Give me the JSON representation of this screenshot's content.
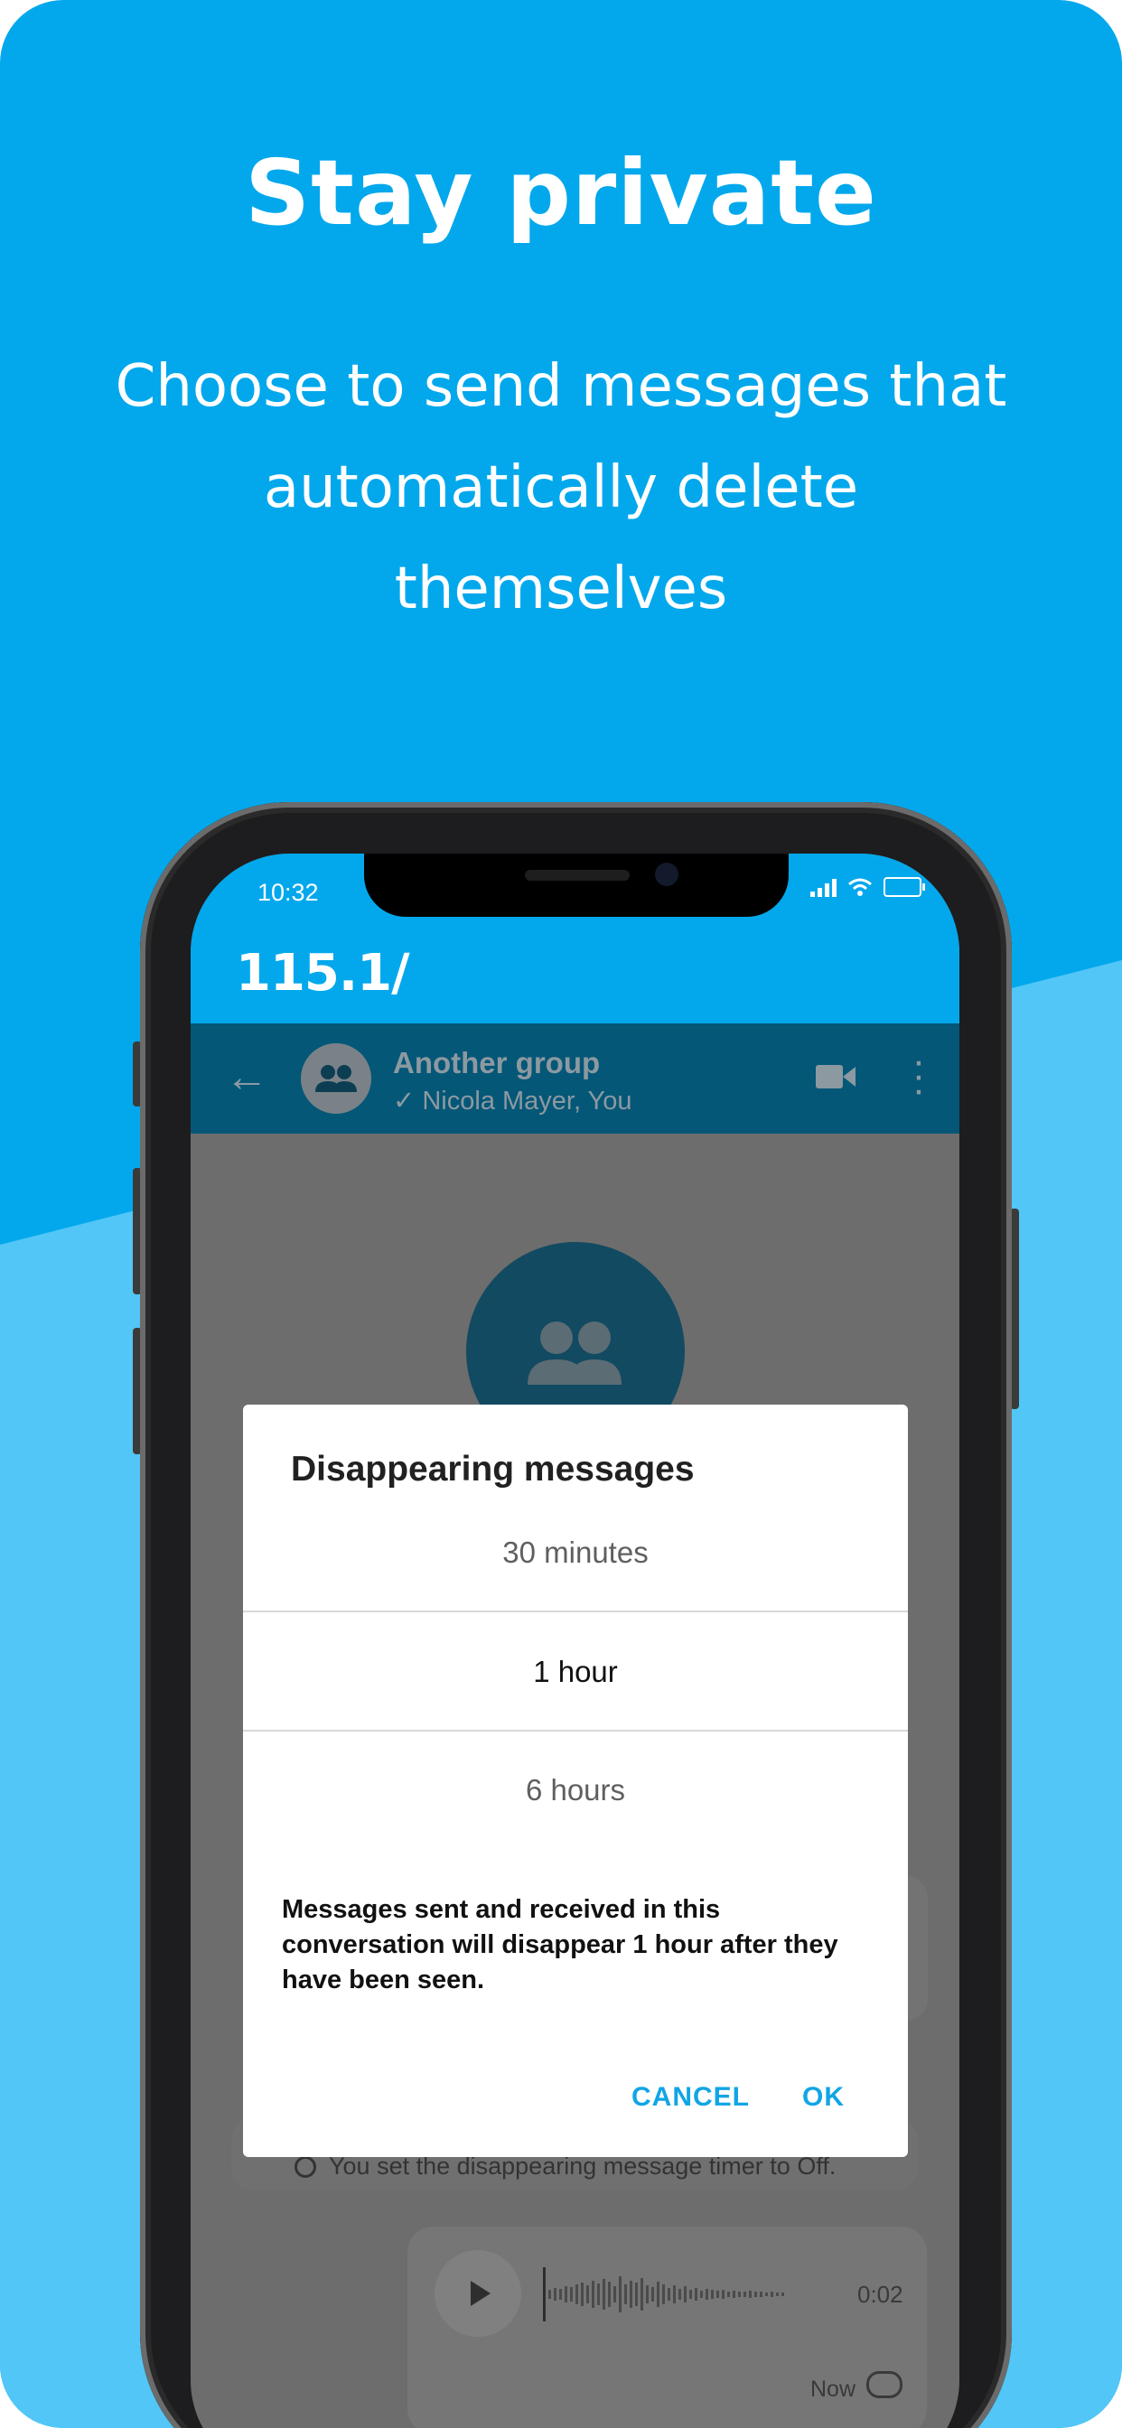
{
  "promo": {
    "headline": "Stay private",
    "subline": "Choose to send messages that automatically delete themselves"
  },
  "status_bar": {
    "time": "10:32"
  },
  "app_bar": {
    "logo": "115.1/"
  },
  "chat_header": {
    "title": "Another group",
    "subtitle": "✓ Nicola Mayer, You"
  },
  "dialog": {
    "title": "Disappearing messages",
    "options": [
      "30 minutes",
      "1 hour",
      "6 hours"
    ],
    "selected": "1 hour",
    "description": "Messages sent and received in this conversation will disappear 1 hour after they have been seen.",
    "cancel_label": "CANCEL",
    "ok_label": "OK"
  },
  "conversation": {
    "system_message": "You set the disappearing message timer to Off.",
    "audio": {
      "duration": "0:02",
      "timestamp": "Now"
    }
  },
  "colors": {
    "brand": "#03a8ec",
    "header_dark": "#045777",
    "accent_button": "#11a5e5"
  }
}
